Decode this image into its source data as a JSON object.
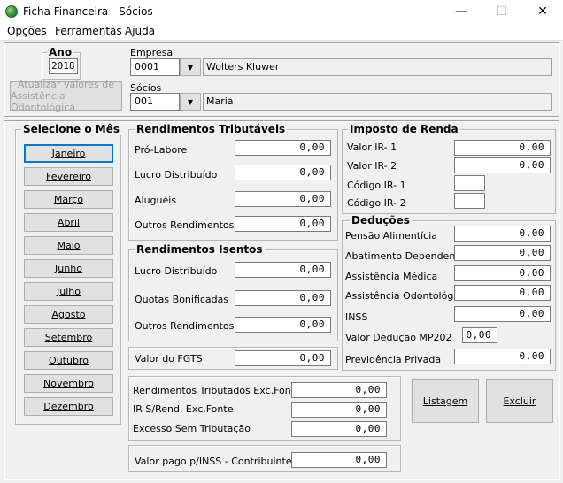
{
  "window": {
    "title": "Ficha Financeira - Sócios",
    "minimize": "—",
    "maximize": "☐",
    "close": "✕"
  },
  "menu": [
    "Opções",
    "Ferramentas",
    "Ajuda"
  ],
  "header": {
    "ano_label": "Ano",
    "ano_value": "2018",
    "empresa_label": "Empresa",
    "empresa_code": "0001",
    "empresa_name": "Wolters Kluwer",
    "socios_label": "Sócios",
    "socios_code": "001",
    "socios_name": "Maria",
    "atualizar_line1": "Atualizar valores de",
    "atualizar_line2": "Assistência Odontológica"
  },
  "meses": {
    "title": "Selecione o Mês",
    "items": [
      "Janeiro",
      "Fevereiro",
      "Março",
      "Abril",
      "Maio",
      "Junho",
      "Julho",
      "Agosto",
      "Setembro",
      "Outubro",
      "Novembro",
      "Dezembro"
    ],
    "selected": "Janeiro"
  },
  "tributaveis": {
    "title": "Rendimentos Tributáveis",
    "rows": [
      {
        "label": "Pró-Labore",
        "value": "0,00"
      },
      {
        "label": "Lucro Distribuído",
        "value": "0,00"
      },
      {
        "label": "Aluguéis",
        "value": "0,00"
      },
      {
        "label": "Outros Rendimentos",
        "value": "0,00"
      }
    ]
  },
  "isentos": {
    "title": "Rendimentos Isentos",
    "rows": [
      {
        "label": "Lucro Distribuído",
        "value": "0,00"
      },
      {
        "label": "Quotas Bonificadas",
        "value": "0,00"
      },
      {
        "label": "Outros Rendimentos",
        "value": "0,00"
      }
    ]
  },
  "fgts": {
    "label": "Valor do FGTS",
    "value": "0,00"
  },
  "imposto": {
    "title": "Imposto de Renda",
    "valor_ir1_label": "Valor IR- 1",
    "valor_ir1": "0,00",
    "valor_ir2_label": "Valor IR- 2",
    "valor_ir2": "0,00",
    "codigo_ir1_label": "Código IR- 1",
    "codigo_ir1": "",
    "codigo_ir2_label": "Código IR- 2",
    "codigo_ir2": ""
  },
  "deducoes": {
    "title": "Deduções",
    "rows": [
      {
        "label": "Pensão Alimentícia",
        "value": "0,00"
      },
      {
        "label": "Abatimento Dependentes",
        "value": "0,00"
      },
      {
        "label": "Assistência Médica",
        "value": "0,00"
      },
      {
        "label": "Assistência Odontológica",
        "value": "0,00"
      },
      {
        "label": "INSS",
        "value": "0,00"
      },
      {
        "label": "Valor Dedução MP202",
        "value": "0,00"
      },
      {
        "label": "Previdência Privada",
        "value": "0,00"
      }
    ]
  },
  "exc_fonte": {
    "rows": [
      {
        "label": "Rendimentos Tributados Exc.Fonte",
        "value": "0,00"
      },
      {
        "label": "IR S/Rend. Exc.Fonte",
        "value": "0,00"
      },
      {
        "label": "Excesso Sem Tributação",
        "value": "0,00"
      }
    ]
  },
  "inss_contribuinte": {
    "label": "Valor pago p/INSS - Contribuinte",
    "value": "0,00"
  },
  "actions": {
    "listagem": "Listagem",
    "excluir": "Excluir"
  }
}
